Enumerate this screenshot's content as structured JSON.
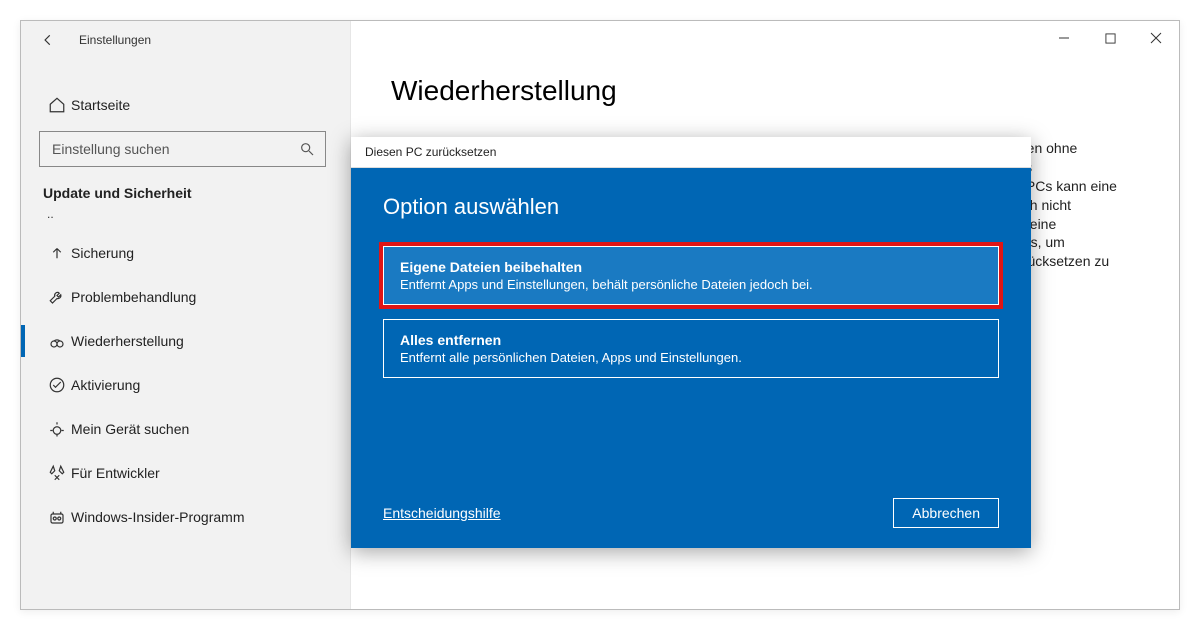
{
  "window": {
    "app_name": "Einstellungen"
  },
  "sidebar": {
    "home": "Startseite",
    "search_placeholder": "Einstellung suchen",
    "section": "Update und Sicherheit",
    "dots": "..",
    "items": [
      {
        "label": "Sicherung",
        "icon": "upload"
      },
      {
        "label": "Problembehandlung",
        "icon": "wrench"
      },
      {
        "label": "Wiederherstellung",
        "icon": "recovery",
        "selected": true
      },
      {
        "label": "Aktivierung",
        "icon": "check"
      },
      {
        "label": "Mein Gerät suchen",
        "icon": "locate"
      },
      {
        "label": "Für Entwickler",
        "icon": "tools"
      },
      {
        "label": "Windows-Insider-Programm",
        "icon": "insider"
      }
    ]
  },
  "main": {
    "title": "Wiederherstellung",
    "bg_text": "men ohne\nCs\ns PCs kann eine\noch nicht\nie eine\n aus, um\nurücksetzen zu"
  },
  "dialog": {
    "window_title": "Diesen PC zurücksetzen",
    "heading": "Option auswählen",
    "options": [
      {
        "title": "Eigene Dateien beibehalten",
        "description": "Entfernt Apps und Einstellungen, behält persönliche Dateien jedoch bei.",
        "highlighted": true
      },
      {
        "title": "Alles entfernen",
        "description": "Entfernt alle persönlichen Dateien, Apps und Einstellungen."
      }
    ],
    "help": "Entscheidungshilfe",
    "cancel": "Abbrechen"
  }
}
